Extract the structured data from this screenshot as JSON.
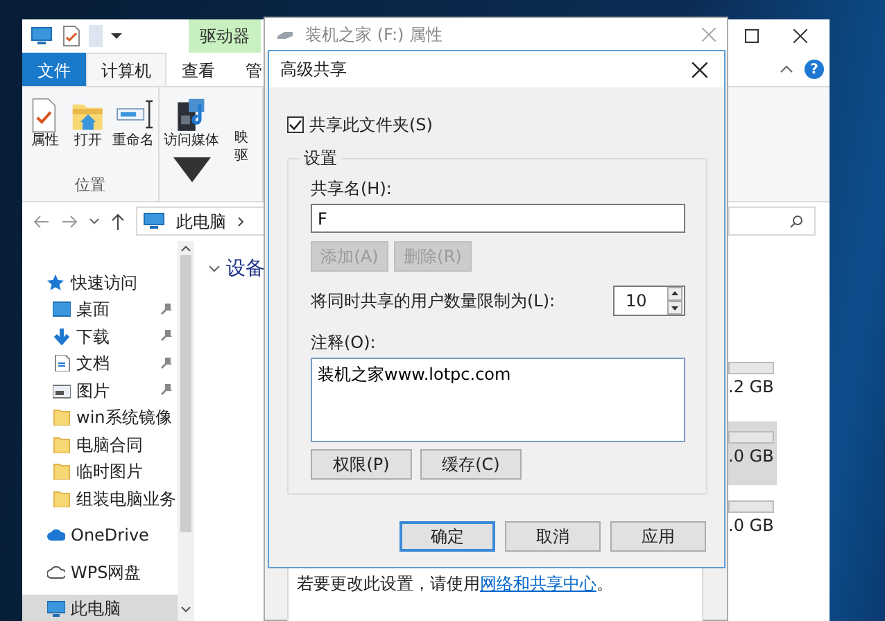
{
  "explorer": {
    "context_tab": "驱动器",
    "ribbon_tabs": [
      {
        "label": "文件",
        "kind": "file",
        "selected": false
      },
      {
        "label": "计算机",
        "kind": "tab",
        "selected": true
      },
      {
        "label": "查看",
        "kind": "tab",
        "selected": false
      },
      {
        "label": "管",
        "kind": "tab",
        "selected": false
      }
    ],
    "help_glyph": "?",
    "ribbon_groups": [
      {
        "label": "位置",
        "buttons": [
          {
            "kind": "properties",
            "lines": [
              "属性"
            ]
          },
          {
            "kind": "open",
            "lines": [
              "打开"
            ]
          },
          {
            "kind": "rename",
            "lines": [
              "重命名"
            ]
          }
        ]
      },
      {
        "buttons": [
          {
            "kind": "media",
            "lines": [
              "访问媒体"
            ],
            "dropdown": true
          },
          {
            "kind": "map",
            "lines": [
              "映",
              "驱"
            ]
          }
        ]
      }
    ],
    "address_path": "此电脑",
    "sidebar": [
      {
        "label": "快速访问",
        "kind": "star",
        "pinned": false,
        "selected": false
      },
      {
        "label": "桌面",
        "kind": "desktop",
        "pinned": true,
        "selected": false
      },
      {
        "label": "下载",
        "kind": "download",
        "pinned": true,
        "selected": false
      },
      {
        "label": "文档",
        "kind": "doc",
        "pinned": true,
        "selected": false
      },
      {
        "label": "图片",
        "kind": "picture",
        "pinned": true,
        "selected": false
      },
      {
        "label": "win系统镜像",
        "kind": "folder",
        "pinned": false,
        "selected": false
      },
      {
        "label": "电脑合同",
        "kind": "folder",
        "pinned": false,
        "selected": false
      },
      {
        "label": "临时图片",
        "kind": "folder",
        "pinned": false,
        "selected": false
      },
      {
        "label": "组装电脑业务",
        "kind": "folder",
        "pinned": false,
        "selected": false
      },
      {
        "label": "OneDrive",
        "kind": "cloud",
        "pinned": false,
        "selected": false
      },
      {
        "label": "WPS网盘",
        "kind": "wps",
        "pinned": false,
        "selected": false
      },
      {
        "label": "此电脑",
        "kind": "pc",
        "pinned": false,
        "selected": true
      }
    ],
    "section_header": "设备",
    "drives": [
      {
        "size": ".2 GB",
        "selected": false
      },
      {
        "size": ".0 GB",
        "selected": true
      },
      {
        "size": ".0 GB",
        "selected": false
      }
    ]
  },
  "properties_dialog": {
    "title": "装机之家 (F:) 属性",
    "note": "若要更改此设置，请使用",
    "link": "网络和共享中心",
    "note_end": "。"
  },
  "sharing_dialog": {
    "title": "高级共享",
    "share_checkbox": {
      "label": "共享此文件夹(S)",
      "checked": true
    },
    "group_label": "设置",
    "share_name_label": "共享名(H):",
    "share_name": "F",
    "name_buttons": [
      {
        "label": "添加(A)",
        "disabled": true
      },
      {
        "label": "删除(R)",
        "disabled": true
      }
    ],
    "limit_label": "将同时共享的用户数量限制为(L):",
    "limit_value": "10",
    "comment_label": "注释(O):",
    "comment": "装机之家www.lotpc.com",
    "extra_buttons": [
      {
        "label": "权限(P)",
        "disabled": false
      },
      {
        "label": "缓存(C)",
        "disabled": false
      }
    ],
    "footer_buttons": [
      {
        "label": "确定",
        "default": true
      },
      {
        "label": "取消",
        "default": false
      },
      {
        "label": "应用",
        "default": false
      }
    ]
  }
}
